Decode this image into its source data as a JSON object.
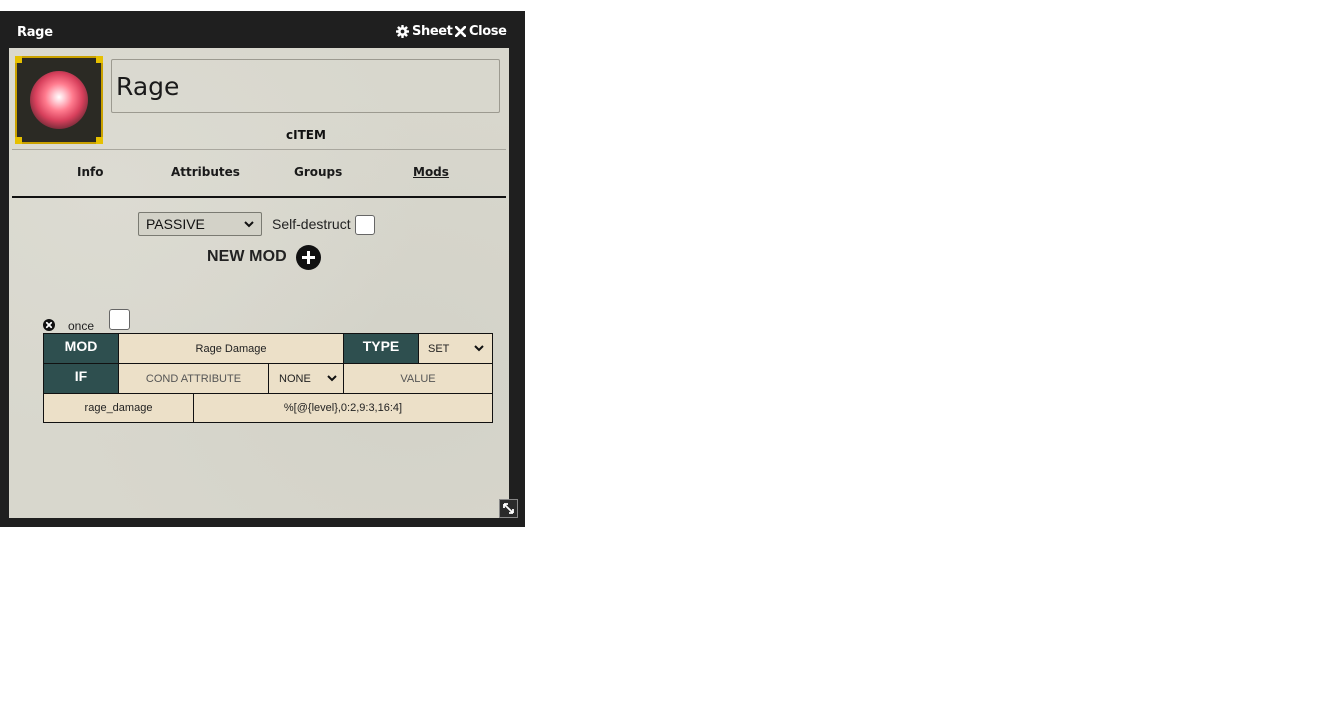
{
  "window": {
    "title": "Rage",
    "sheet_label": "Sheet",
    "close_label": "Close"
  },
  "item": {
    "name": "Rage",
    "type_label": "cITEM"
  },
  "tabs": [
    {
      "label": "Info",
      "active": false
    },
    {
      "label": "Attributes",
      "active": false
    },
    {
      "label": "Groups",
      "active": false
    },
    {
      "label": "Mods",
      "active": true
    }
  ],
  "mods_panel": {
    "mode_value": "PASSIVE",
    "self_destruct_label": "Self-destruct",
    "self_destruct_checked": false,
    "new_mod_label": "NEW MOD"
  },
  "mod": {
    "once_label": "once",
    "once_checked": false,
    "mod_header": "MOD",
    "mod_name": "Rage Damage",
    "type_header": "TYPE",
    "type_value": "SET",
    "if_header": "IF",
    "cond_attribute_placeholder": "COND ATTRIBUTE",
    "cond_operator": "NONE",
    "value_placeholder": "VALUE",
    "attribute": "rage_damage",
    "formula": "%[@{level},0:2,9:3,16:4]"
  },
  "colors": {
    "titlebar": "#1f1f1f",
    "table_header": "#2e4f4f",
    "table_cell": "#ece0c8",
    "avatar_border": "#c9a100"
  },
  "icons": [
    "gear-icon",
    "close-icon",
    "plus-circle-icon",
    "remove-circle-icon",
    "resize-icon",
    "chevron-down-icon"
  ]
}
